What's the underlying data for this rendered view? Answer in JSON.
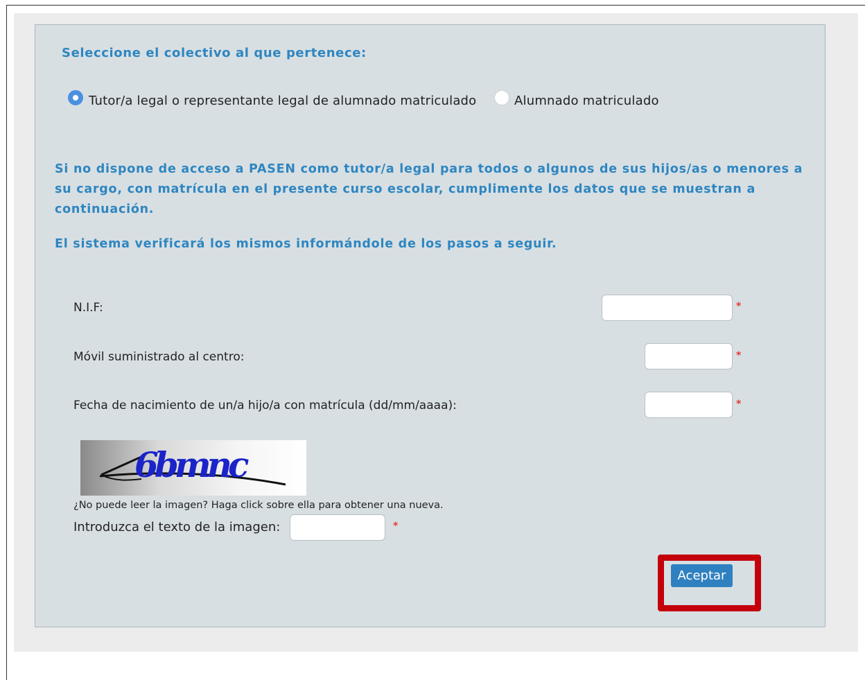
{
  "form": {
    "section_title": "Seleccione el colectivo al que pertenece:",
    "options": [
      {
        "label": "Tutor/a legal o representante legal de alumnado matriculado",
        "selected": true
      },
      {
        "label": "Alumnado matriculado",
        "selected": false
      }
    ],
    "info_paragraph": "Si no dispone de acceso a PASEN como tutor/a legal para todos o algunos de sus hijos/as o menores a su cargo, con matrícula en el presente curso escolar, cumplimente los datos que se muestran a continuación.",
    "info_verify": "El sistema verificará los mismos informándole de los pasos a seguir.",
    "fields": {
      "nif_label": "N.I.F:",
      "nif_value": "",
      "movil_label": "Móvil suministrado al centro:",
      "movil_value": "",
      "fecha_label": "Fecha de nacimiento de un/a hijo/a con matrícula (dd/mm/aaaa):",
      "fecha_value": "",
      "required_marker": "*"
    },
    "captcha": {
      "image_text": "6bmnc",
      "hint": "¿No puede leer la imagen? Haga click sobre ella para obtener una nueva.",
      "label": "Introduzca el texto de la imagen:",
      "value": ""
    },
    "submit_label": "Aceptar"
  },
  "colors": {
    "accent_text": "#2e86c1",
    "panel_bg": "#d8dfe2",
    "button_bg": "#2f80c0",
    "highlight": "#c4000b",
    "required": "#e53935"
  }
}
